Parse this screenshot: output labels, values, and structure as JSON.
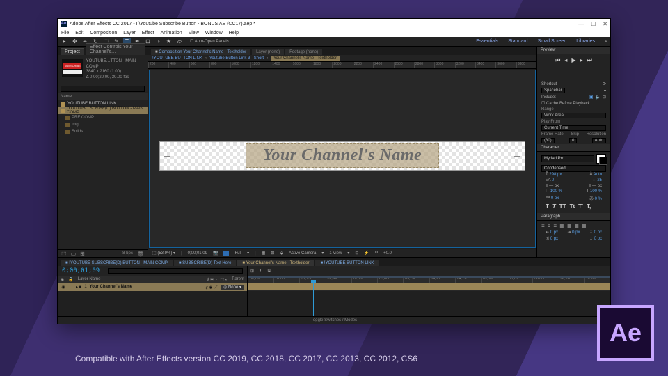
{
  "promo_line": "Compatible with After Effects version CC 2019, CC 2018, CC 2017, CC 2013, CC 2012, CS6",
  "logo": "Ae",
  "titlebar": {
    "icon": "Ae",
    "title": "Adobe After Effects CC 2017 - I:\\Youtube Subscribe Button - BONUS AE (CC17).aep *"
  },
  "menu": [
    "File",
    "Edit",
    "Composition",
    "Layer",
    "Effect",
    "Animation",
    "View",
    "Window",
    "Help"
  ],
  "toolbar": {
    "items": [
      "▸",
      "✥",
      "⌖",
      "↻",
      "⬚",
      "✎",
      "T",
      "✒",
      "⊡",
      "◑",
      "★",
      "⤽"
    ],
    "active": 6,
    "auto_open": "Auto-Open Panels",
    "workspaces": [
      "Essentials",
      "Standard",
      "Small Screen",
      "Libraries"
    ]
  },
  "project": {
    "tabs": [
      "Project",
      "Effect Controls Your Channel's…"
    ],
    "active": 0,
    "comp_name": "YOUTUBE…TTON - MAIN COMP",
    "meta1": "3840 x 2160 (1.00)",
    "meta2": "Δ 0;00;20;00, 30.00 fps",
    "search_ph": "",
    "header": "Name",
    "assets": [
      {
        "name": "YOUTUBE BUTTON LINK",
        "hi": false
      },
      {
        "name": "!YOUTUB…SCRIBE(D) BUTTON - MAIN COMP",
        "hi": true
      }
    ],
    "folders": [
      "PRE COMP",
      "img",
      "Solids"
    ]
  },
  "composition": {
    "tabs": [
      {
        "l": "Composition Your Channel's Name - Textholder",
        "on": true
      },
      {
        "l": "Layer (none)",
        "on": false
      },
      {
        "l": "Footage (none)",
        "on": false
      }
    ],
    "crumb": [
      "!YOUTUBE BUTTON LINK",
      "Youtube Button Link 3 - Short",
      "Your Channel's Name - Textholder"
    ],
    "ruler": [
      "200",
      "400",
      "600",
      "800",
      "1000",
      "1200",
      "1400",
      "1600",
      "1800",
      "2000",
      "2200",
      "2400",
      "2600",
      "2800",
      "3000",
      "3200",
      "3400",
      "3600",
      "3800"
    ],
    "text": "Your Channel's Name",
    "status": {
      "zoom": "(53.9%)",
      "tc": "0;00;01;09",
      "res": "Full",
      "view": "Active Camera",
      "views": "1 View",
      "exp": "+0.0"
    }
  },
  "preview": {
    "title": "Preview",
    "shortcut": "Spacebar",
    "include": "Include:",
    "cache": "Cache Before Playback",
    "range": "Range",
    "workarea": "Work Area",
    "playfrom": "Play From",
    "current": "Current Time",
    "framerate": "Frame Rate",
    "skip": "Skip",
    "resolution": "Resolution",
    "fps": "(30)",
    "skipv": "0",
    "res": "Auto"
  },
  "character": {
    "title": "Character",
    "font": "Myriad Pro",
    "style": "Condensed",
    "size": "298 px",
    "leading": "Auto",
    "kerning": "0",
    "tracking": "25",
    "vscale": "100 %",
    "hscale": "100 %",
    "baseline": "0 px",
    "tsume": "0 %",
    "styles": [
      "T",
      "T",
      "TT",
      "Tt",
      "T′",
      "T,"
    ]
  },
  "paragraph": {
    "title": "Paragraph",
    "indL": "0 px",
    "indR": "0 px",
    "spB": "0 px",
    "indF": "0 px",
    "spA": "0 px"
  },
  "timeline": {
    "tabs": [
      {
        "l": "!YOUTUBE SUBSCRIBE(D) BUTTON - MAIN COMP",
        "on": false
      },
      {
        "l": "SUBSCRIBE(D) Text Here",
        "on": false
      },
      {
        "l": "Your Channel's Name - Textholder",
        "on": true
      },
      {
        "l": "!YOUTUBE BUTTON LINK",
        "on": false
      }
    ],
    "timecode": "0;00;01;09",
    "layer_hdr": "Layer Name",
    "parent_hdr": "Parent",
    "layer": {
      "num": "1",
      "name": "Your Channel's Name",
      "parent": "None"
    },
    "ticks": [
      "00;15f",
      "01;00f",
      "01;15f",
      "02;00f",
      "02;15f",
      "03;00f",
      "03;15f",
      "04;00f",
      "04;15f",
      "05;00f",
      "05;15f",
      "06;00f",
      "06;15f",
      "07;00f"
    ],
    "footer": "Toggle Switches / Modes"
  }
}
